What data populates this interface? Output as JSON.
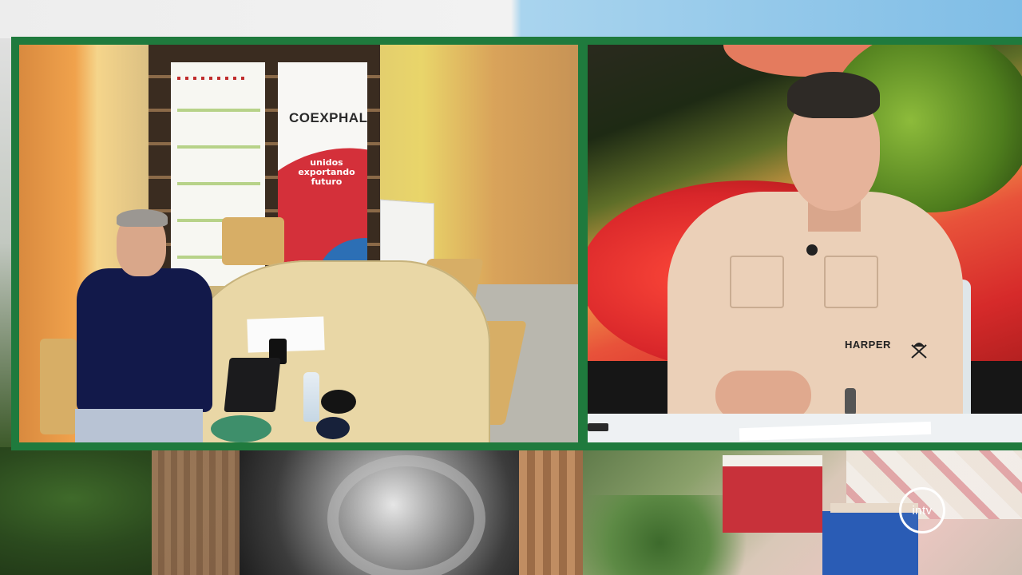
{
  "left_feed": {
    "banner_brand": "COEXPHAL",
    "banner_slogan": [
      "unidos",
      "exportando",
      "futuro"
    ]
  },
  "right_feed": {
    "shirt_brand": "HARPER"
  },
  "channel_logo": {
    "text": "intv"
  },
  "colors": {
    "frame_green": "#1f7a3d",
    "banner_red": "#d4303a",
    "banner_blue": "#2c6fb5",
    "logo_white": "#ffffff"
  }
}
